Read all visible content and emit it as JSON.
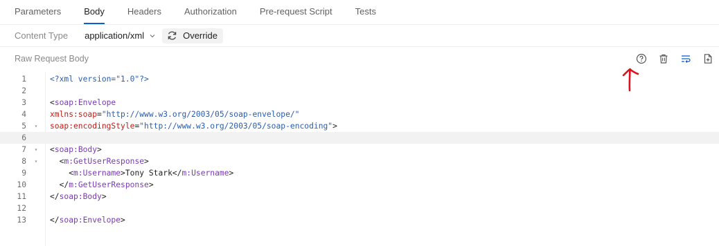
{
  "tabs": [
    {
      "label": "Parameters",
      "active": false
    },
    {
      "label": "Body",
      "active": true
    },
    {
      "label": "Headers",
      "active": false
    },
    {
      "label": "Authorization",
      "active": false
    },
    {
      "label": "Pre-request Script",
      "active": false
    },
    {
      "label": "Tests",
      "active": false
    }
  ],
  "content_type": {
    "label": "Content Type",
    "value": "application/xml",
    "override_label": "Override"
  },
  "raw_body": {
    "title": "Raw Request Body",
    "tools": [
      "help-icon",
      "trash-icon",
      "wrap-lines-icon",
      "new-file-icon"
    ]
  },
  "colors": {
    "accent": "#0b5fd1",
    "annotation_arrow": "#e0101a"
  },
  "editor": {
    "active_line": 6,
    "lines": [
      {
        "n": "1",
        "fold": false,
        "code": "<?xml version=\"1.0\"?>"
      },
      {
        "n": "2",
        "fold": false,
        "code": ""
      },
      {
        "n": "3",
        "fold": false,
        "code": "<soap:Envelope"
      },
      {
        "n": "4",
        "fold": false,
        "code": "xmlns:soap=\"http://www.w3.org/2003/05/soap-envelope/\""
      },
      {
        "n": "5",
        "fold": true,
        "code": "soap:encodingStyle=\"http://www.w3.org/2003/05/soap-encoding\">"
      },
      {
        "n": "6",
        "fold": false,
        "code": ""
      },
      {
        "n": "7",
        "fold": true,
        "code": "<soap:Body>"
      },
      {
        "n": "8",
        "fold": true,
        "code": "  <m:GetUserResponse>"
      },
      {
        "n": "9",
        "fold": false,
        "code": "    <m:Username>Tony Stark</m:Username>"
      },
      {
        "n": "10",
        "fold": false,
        "code": "  </m:GetUserResponse>"
      },
      {
        "n": "11",
        "fold": false,
        "code": "</soap:Body>"
      },
      {
        "n": "12",
        "fold": false,
        "code": ""
      },
      {
        "n": "13",
        "fold": false,
        "code": "</soap:Envelope>"
      }
    ]
  }
}
